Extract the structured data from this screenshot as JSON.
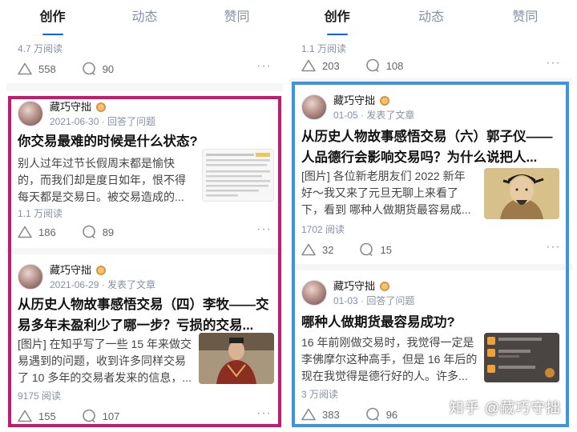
{
  "tabs": [
    "创作",
    "动态",
    "赞同"
  ],
  "left": {
    "prev": {
      "views": "4.7 万阅读",
      "likes": "558",
      "comments": "90"
    },
    "cards": [
      {
        "author": "藏巧守拙",
        "sub": "2021-06-30 · 回答了问题",
        "title": "你交易最难的时候是什么状态?",
        "excerpt": [
          "别人过年过节长假周末都是愉快",
          "的，而我们却是度日如年，恨不得",
          "每天都是交易日。被交易造成的..."
        ],
        "views": "1.1 万阅读",
        "likes": "186",
        "comments": "89"
      },
      {
        "author": "藏巧守拙",
        "sub": "2021-06-29 · 发表了文章",
        "title": [
          "从历史人物故事感悟交易（四）李牧——交",
          "易多年未盈利少了哪一步？亏损的交易..."
        ],
        "excerpt": [
          "[图片] 在知乎写了一些 15 年来做交",
          "易遇到的问题，收到许多同样交易",
          "了 10 多年的交易者发来的信息，..."
        ],
        "views": "9175 阅读",
        "likes": "155",
        "comments": "107"
      }
    ]
  },
  "right": {
    "prev": {
      "views": "1.1 万阅读",
      "likes": "203",
      "comments": "108"
    },
    "cards": [
      {
        "author": "藏巧守拙",
        "sub": "01-05 · 发表了文章",
        "title": [
          "从历史人物故事感悟交易（六）郭子仪——",
          "人品德行会影响交易吗？为什么说把人..."
        ],
        "excerpt": [
          "[图片] 各位新老朋友们 2022 新年",
          "好～我又来了元旦无聊上来看了",
          "下，看到 哪种人做期货最容易成..."
        ],
        "views": "1702 阅读",
        "likes": "32",
        "comments": "15"
      },
      {
        "author": "藏巧守拙",
        "sub": "01-03 · 回答了问题",
        "title": "哪种人做期货最容易成功?",
        "excerpt": [
          "16 年前刚做交易时，我觉得一定是",
          "李佛摩尔这种高手，但是 16 年后的",
          "现在我觉得是德行好的人。许多..."
        ],
        "views": "3 万阅读",
        "likes": "383",
        "comments": "96"
      }
    ]
  },
  "more_label": "···",
  "watermark": "知乎 @藏巧守拙",
  "colors": {
    "highlight_left": "#c41a73",
    "highlight_right": "#3d95e0",
    "tab_indicator": "#0066ff"
  }
}
